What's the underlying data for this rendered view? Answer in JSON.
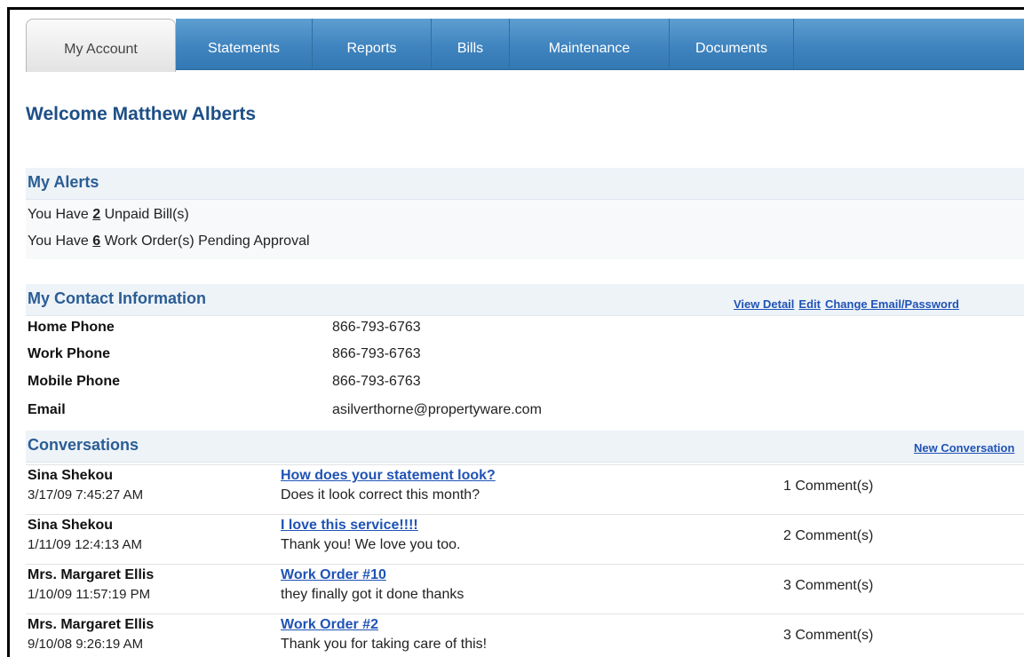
{
  "tabs": [
    {
      "label": "My Account",
      "active": true
    },
    {
      "label": "Statements"
    },
    {
      "label": "Reports"
    },
    {
      "label": "Bills"
    },
    {
      "label": "Maintenance"
    },
    {
      "label": "Documents"
    }
  ],
  "welcome": "Welcome Matthew Alberts",
  "alerts": {
    "title": "My Alerts",
    "line1": {
      "prefix": "You Have ",
      "count": "2",
      "suffix": " Unpaid Bill(s)"
    },
    "line2": {
      "prefix": "You Have ",
      "count": "6",
      "suffix": " Work Order(s) Pending Approval"
    }
  },
  "contact": {
    "title": "My Contact Information",
    "links": {
      "view_detail": "View Detail",
      "edit": "Edit",
      "change": "Change Email/Password"
    },
    "rows": [
      {
        "label": "Home Phone",
        "value": "866-793-6763"
      },
      {
        "label": "Work Phone",
        "value": "866-793-6763"
      },
      {
        "label": "Mobile Phone",
        "value": "866-793-6763"
      },
      {
        "label": "Email",
        "value": "asilverthorne@propertyware.com"
      }
    ]
  },
  "conversations": {
    "title": "Conversations",
    "new_link": "New Conversation",
    "rows": [
      {
        "name": "Sina Shekou",
        "date": "3/17/09 7:45:27 AM",
        "subject": "How does your statement look?",
        "body": "Does it look correct this month?",
        "comments": "1 Comment(s)"
      },
      {
        "name": "Sina Shekou",
        "date": "1/11/09 12:4:13 AM",
        "subject": "I love this service!!!!",
        "body": "Thank you! We love you too.",
        "comments": "2 Comment(s)"
      },
      {
        "name": "Mrs. Margaret Ellis",
        "date": "1/10/09 11:57:19 PM",
        "subject": "Work Order #10",
        "body": "they finally got it done thanks",
        "comments": "3 Comment(s)"
      },
      {
        "name": "Mrs. Margaret Ellis",
        "date": "9/10/08 9:26:19 AM",
        "subject": "Work Order #2",
        "body": "Thank you for taking care of this!",
        "comments": "3 Comment(s)"
      }
    ]
  },
  "colors": {
    "accent": "#1d4f86",
    "tab_blue": "#3f84bf",
    "link": "#1f53b5"
  }
}
